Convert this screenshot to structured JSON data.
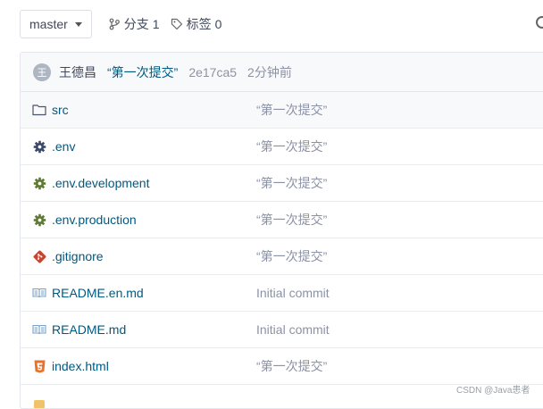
{
  "toolbar": {
    "branch": "master",
    "branches_label": "分支",
    "branches_count": "1",
    "tags_label": "标签",
    "tags_count": "0"
  },
  "commit": {
    "avatar_initial": "王",
    "author": "王德昌",
    "message": "“第一次提交”",
    "sha": "2e17ca5",
    "time": "2分钟前"
  },
  "files": [
    {
      "name": "src",
      "commit": "“第一次提交”",
      "icon": "folder-icon"
    },
    {
      "name": ".env",
      "commit": "“第一次提交”",
      "icon": "gear-icon"
    },
    {
      "name": ".env.development",
      "commit": "“第一次提交”",
      "icon": "gear-icon"
    },
    {
      "name": ".env.production",
      "commit": "“第一次提交”",
      "icon": "gear-icon"
    },
    {
      "name": ".gitignore",
      "commit": "“第一次提交”",
      "icon": "git-icon"
    },
    {
      "name": "README.en.md",
      "commit": "Initial commit",
      "icon": "book-icon"
    },
    {
      "name": "README.md",
      "commit": "Initial commit",
      "icon": "book-icon"
    },
    {
      "name": "index.html",
      "commit": "“第一次提交”",
      "icon": "html5-icon"
    }
  ],
  "colors": {
    "link": "#005980",
    "muted": "#8c92a4",
    "gear_dark": "#3b4a6b",
    "gear_olive": "#5e7a34",
    "git": "#c64531",
    "html5": "#e9712a",
    "book": "#7aa2c7"
  },
  "watermark": "CSDN @Java患者"
}
